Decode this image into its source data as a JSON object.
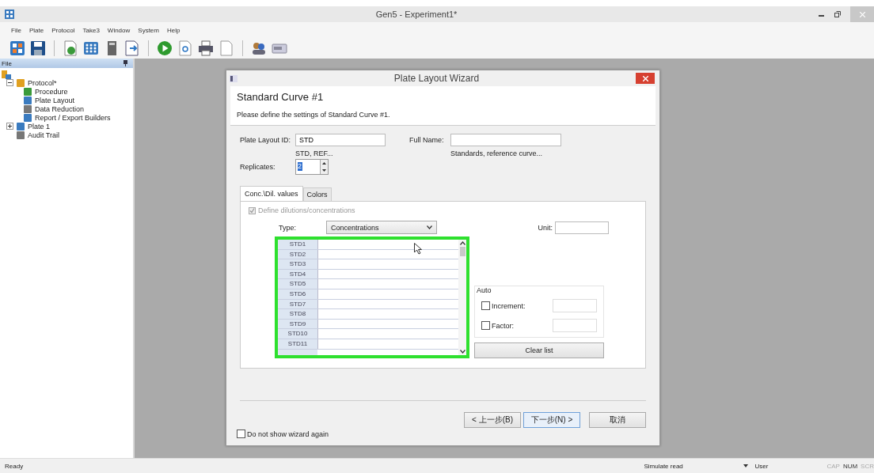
{
  "window": {
    "title": "Gen5 - Experiment1*"
  },
  "menu": [
    "File",
    "Plate",
    "Protocol",
    "Take3",
    "Window",
    "System",
    "Help"
  ],
  "sidebar": {
    "title": "File",
    "tree": [
      {
        "label": "Protocol*",
        "expanded": true,
        "children": [
          {
            "label": "Procedure"
          },
          {
            "label": "Plate Layout"
          },
          {
            "label": "Data Reduction"
          },
          {
            "label": "Report / Export Builders"
          }
        ]
      },
      {
        "label": "Plate 1",
        "expanded": false
      },
      {
        "label": "Audit Trail"
      }
    ]
  },
  "dialog": {
    "title": "Plate Layout Wizard",
    "heading": "Standard Curve #1",
    "description": "Please define the settings of Standard Curve #1.",
    "plate_layout_id": {
      "label": "Plate Layout ID:",
      "value": "STD",
      "hint": "STD, REF..."
    },
    "full_name": {
      "label": "Full Name:",
      "hint": "Standards, reference curve..."
    },
    "replicates": {
      "label": "Replicates:",
      "value": "2"
    },
    "tabs": [
      {
        "label": "Conc.\\Dil. values",
        "selected": true
      },
      {
        "label": "Colors",
        "selected": false
      }
    ],
    "define": {
      "label": "Define dilutions/concentrations",
      "checked": true,
      "disabled": true
    },
    "type": {
      "label": "Type:",
      "value": "Concentrations"
    },
    "unit": {
      "label": "Unit:"
    },
    "grid_rows": [
      "STD1",
      "STD2",
      "STD3",
      "STD4",
      "STD5",
      "STD6",
      "STD7",
      "STD8",
      "STD9",
      "STD10",
      "STD11"
    ],
    "auto": {
      "title": "Auto",
      "options": [
        {
          "label": "Increment:",
          "checked": false
        },
        {
          "label": "Factor:",
          "checked": false
        }
      ]
    },
    "clear_button": "Clear list",
    "buttons": [
      {
        "label": "< 上一步(B)",
        "default": false
      },
      {
        "label": "下一步(N) >",
        "default": true
      },
      {
        "label": "取消",
        "default": false
      }
    ],
    "dont_show": {
      "label": "Do not show wizard again",
      "checked": false
    }
  },
  "status_bar": {
    "message": "Ready",
    "mode": "Simulate read",
    "user": "User",
    "indicators": [
      {
        "label": "CAP",
        "on": false
      },
      {
        "label": "NUM",
        "on": true
      },
      {
        "label": "SCR",
        "on": false
      }
    ]
  }
}
